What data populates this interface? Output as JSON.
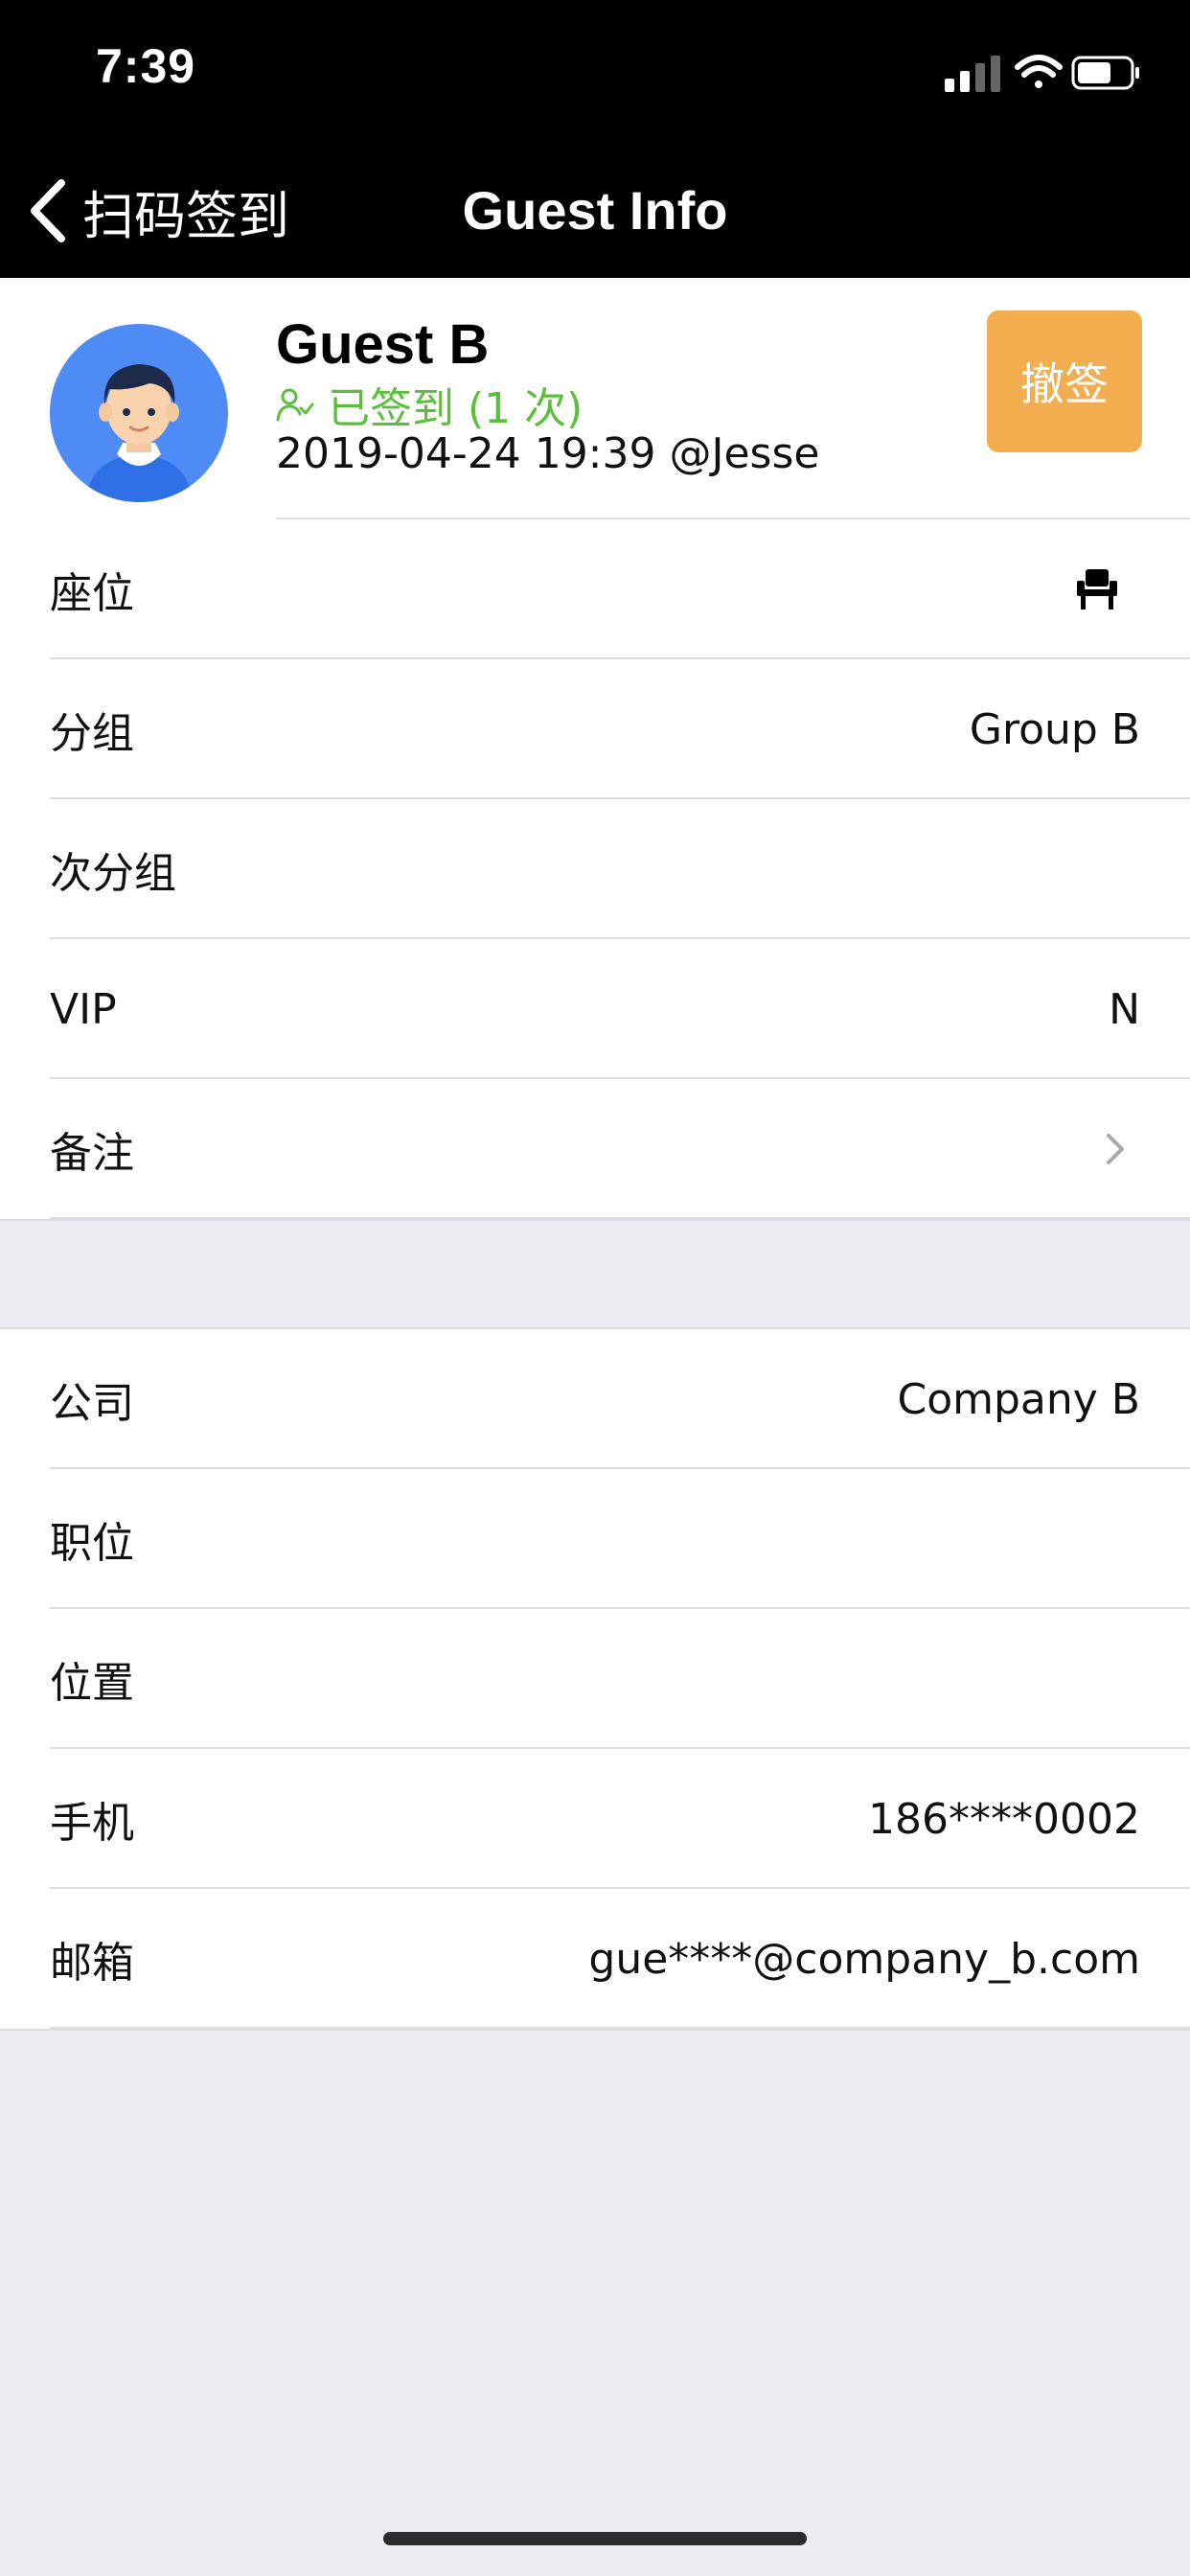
{
  "status_bar": {
    "time": "7:39"
  },
  "nav": {
    "back_label": "扫码签到",
    "title": "Guest Info"
  },
  "guest": {
    "name": "Guest B",
    "checkin_status": "已签到 (1 次)",
    "checkin_time": "2019-04-24 19:39 @Jesse",
    "revoke_label": "撤签"
  },
  "colors": {
    "checked_in": "#5bbf3b",
    "revoke": "#f2ad4e",
    "nav_bg": "#000000",
    "avatar_bg": "#4f8bf5"
  },
  "details": {
    "seat_label": "座位",
    "group_label": "分组",
    "group_value": "Group B",
    "subgroup_label": "次分组",
    "subgroup_value": "",
    "vip_label": "VIP",
    "vip_value": "N",
    "notes_label": "备注"
  },
  "contact": {
    "company_label": "公司",
    "company_value": "Company B",
    "position_label": "职位",
    "position_value": "",
    "location_label": "位置",
    "location_value": "",
    "mobile_label": "手机",
    "mobile_value": "186****0002",
    "email_label": "邮箱",
    "email_value": "gue****@company_b.com"
  },
  "icons": {
    "back": "chevron-left-icon",
    "checkin": "user-check-icon",
    "seat": "seat-icon",
    "notes": "chevron-right-icon"
  }
}
